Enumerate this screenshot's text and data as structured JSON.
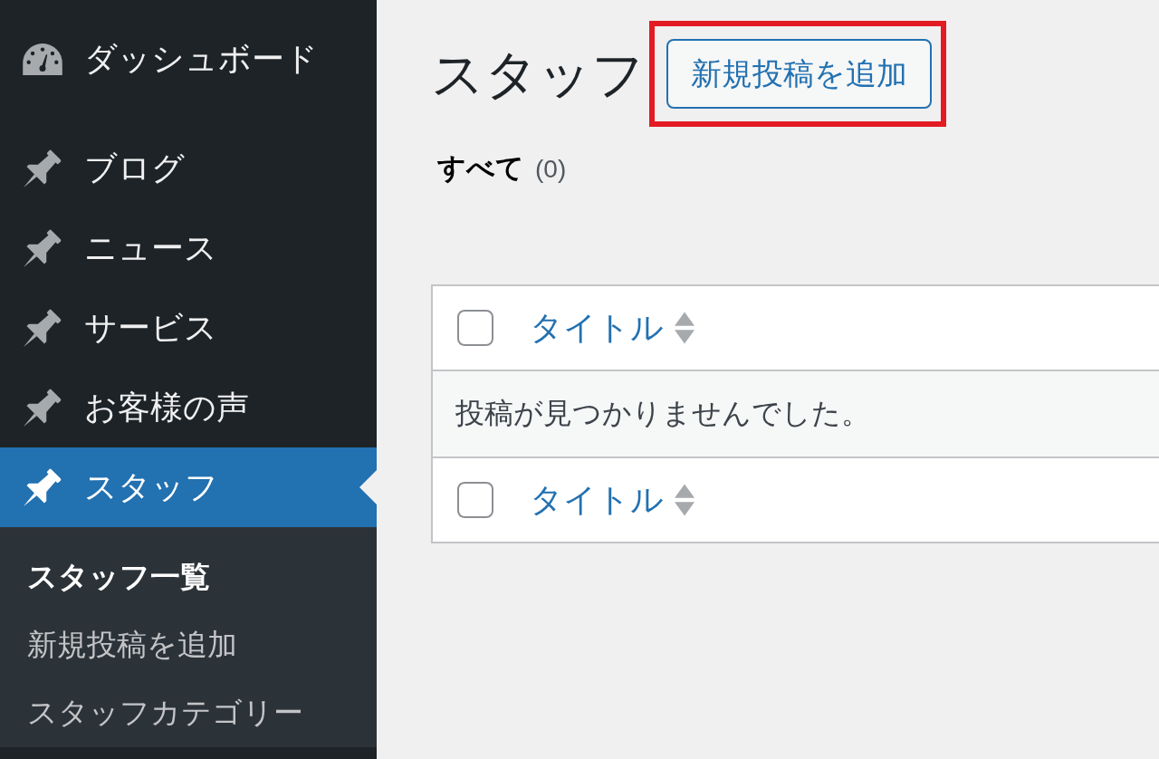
{
  "sidebar": {
    "items": [
      {
        "label": "ダッシュボード",
        "kind": "dashboard",
        "selected": false
      },
      {
        "label": "ブログ",
        "kind": "post_type",
        "selected": false
      },
      {
        "label": "ニュース",
        "kind": "post_type",
        "selected": false
      },
      {
        "label": "サービス",
        "kind": "post_type",
        "selected": false
      },
      {
        "label": "お客様の声",
        "kind": "post_type",
        "selected": false
      },
      {
        "label": "スタッフ",
        "kind": "post_type",
        "selected": true,
        "submenu": [
          {
            "label": "スタッフ一覧",
            "selected": true
          },
          {
            "label": "新規投稿を追加",
            "selected": false
          },
          {
            "label": "スタッフカテゴリー",
            "selected": false
          }
        ]
      }
    ]
  },
  "page": {
    "title": "スタッフ",
    "add_new_button": {
      "label": "新規投稿を追加",
      "highlighted": true
    },
    "filters": [
      {
        "label": "すべて",
        "count": "(0)",
        "selected": true
      }
    ],
    "table": {
      "header": {
        "checked": false,
        "column": "タイトル"
      },
      "empty_message": "投稿が見つかりませんでした。",
      "footer": {
        "checked": false,
        "column": "タイトル"
      }
    }
  }
}
